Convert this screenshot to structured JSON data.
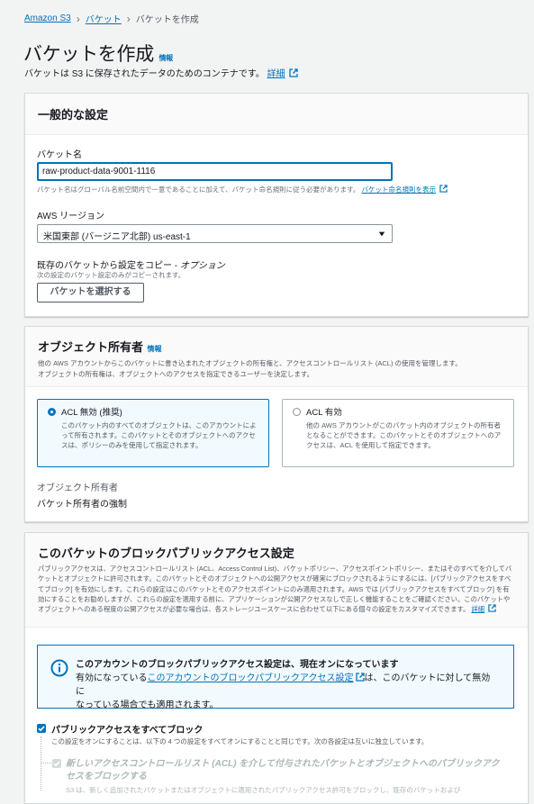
{
  "breadcrumb": {
    "items": [
      "Amazon S3",
      "バケット",
      "バケットを作成"
    ]
  },
  "page": {
    "title": "バケットを作成",
    "info": "情報",
    "description": "バケットは S3 に保存されたデータのためのコンテナです。",
    "details_link": "詳細"
  },
  "general": {
    "title": "一般的な設定",
    "bucket_name_label": "バケット名",
    "bucket_name_value": "raw-product-data-9001-1116",
    "bucket_name_hint": "バケット名はグローバル名前空間内で一意であることに加えて、バケット命名規則に従う必要があります。",
    "naming_rules_link": "バケット命名規則を表示",
    "region_label": "AWS リージョン",
    "region_value": "米国東部 (バージニア北部) us-east-1",
    "copy_label": "既存のバケットから設定をコピー - ",
    "copy_optional": "オプション",
    "copy_hint": "次の設定のバケット設定のみがコピーされます。",
    "choose_bucket_button": "バケットを選択する"
  },
  "ownership": {
    "title": "オブジェクト所有者",
    "info": "情報",
    "description_1": "他の AWS アカウントからこのバケットに書き込まれたオブジェクトの所有権と、アクセスコントロールリスト (ACL) の使用を管理します。",
    "description_2": "オブジェクトの所有権は、オブジェクトへのアクセスを指定できるユーザーを決定します。",
    "option_disabled_title": "ACL 無効 (推奨)",
    "option_disabled_desc": "このバケット内のすべてのオブジェクトは、このアカウントによって所有されます。このバケットとそのオブジェクトへのアクセスは、ポリシーのみを使用して指定されます。",
    "option_enabled_title": "ACL 有効",
    "option_enabled_desc": "他の AWS アカウントがこのバケット内のオブジェクトの所有者となることができます。このバケットとそのオブジェクトへのアクセスは、ACL を使用して指定できます。",
    "owner_label": "オブジェクト所有者",
    "owner_value": "バケット所有者の強制"
  },
  "block_public": {
    "title": "このバケットのブロックパブリックアクセス設定",
    "description": "パブリックアクセスは、アクセスコントロールリスト (ACL、Access Control List)、バケットポリシー、アクセスポイントポリシー、またはそのすべてを介してバケットとオブジェクトに許可されます。このバケットとそのオブジェクトへの公開アクセスが確実にブロックされるようにするには、[パブリックアクセスをすべてブロック] を有効にします。これらの設定はこのバケットとそのアクセスポイントにのみ適用されます。AWS では [パブリックアクセスをすべてブロック] を有効にすることをお勧めしますが、これらの設定を適用する前に、アプリケーションが公開アクセスなしで正しく機能することをご確認ください。このバケットやオブジェクトへのある程度の公開アクセスが必要な場合は、各ストレージユースケースに合わせて以下にある個々の設定をカスタマイズできます。",
    "details_link": "詳細",
    "alert_title": "このアカウントのブロックパブリックアクセス設定は、現在オンになっています",
    "alert_text_1": "有効になっている",
    "alert_link": "このアカウントのブロックパブリックアクセス設定",
    "alert_text_2": "は、このバケットに対して無効に",
    "alert_text_3": "なっている場合でも適用されます。",
    "block_all_label": "パブリックアクセスをすべてブロック",
    "block_all_desc": "この設定をオンにすることは、以下の 4 つの設定をすべてオンにすることと同じです。次の各設定は互いに独立しています。",
    "acl_new_label": "新しいアクセスコントロールリスト (ACL) を介して付与されたバケットとオブジェクトへのパブリックアクセスをブロックする",
    "acl_new_desc": "S3 は、新しく追加されたバケットまたはオブジェクトに適用されたパブリックアクセス許可をブロックし、既存のバケットおよび"
  }
}
